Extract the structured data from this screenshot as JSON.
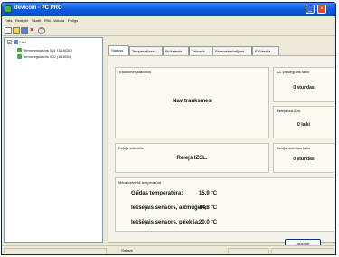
{
  "app": {
    "title": "devicom - PC PRO"
  },
  "menu": {
    "items": [
      "Fails",
      "Rediģēt",
      "Skatīt",
      "Rīki",
      "Valoda",
      "Palīgs"
    ]
  },
  "toolbar": {
    "icons": [
      "new-icon",
      "open-icon",
      "save-icon",
      "delete-icon",
      "help-icon"
    ],
    "help_glyph": "?"
  },
  "tree": {
    "root_label": "Visi",
    "toggle": "−",
    "nodes": [
      "Termoregulators 001 (1B163C)",
      "Termoregulators 002 (1B1654)"
    ]
  },
  "tabs": [
    "Statuss",
    "Temperatūras",
    "Pulkstenis",
    "Taimeris",
    "Parametestatījumi",
    "EVVersija"
  ],
  "status": {
    "alarms_label": "Trauksmes stāvoklis",
    "alarms_value": "Nav trauksmes",
    "ac_label": "AC pieslēgums laiks",
    "ac_value": "0 stundas",
    "relay_off_label": "Releja izsl.ilzsl.",
    "relay_off_value": "0 laiki",
    "relay_label": "Releja stāvoklis",
    "relay_value": "Relejs IZSL.",
    "relay_hours_label": "Releja darbības laiks",
    "relay_hours_value": "0 stundas",
    "temps_label": "Mēra uztvertā temperatūra",
    "temps": [
      {
        "name": "Grīdas temperatūra:",
        "value": "15,9 °C"
      },
      {
        "name": "Iekšējais sensors, aizmugure:",
        "value": "44,8 °C"
      },
      {
        "name": "Iekšējais sensors, priekša:",
        "value": "20,0 °C"
      }
    ],
    "refresh_label": "Atjaunot"
  },
  "statusbar": {
    "text": "Gatavs"
  }
}
